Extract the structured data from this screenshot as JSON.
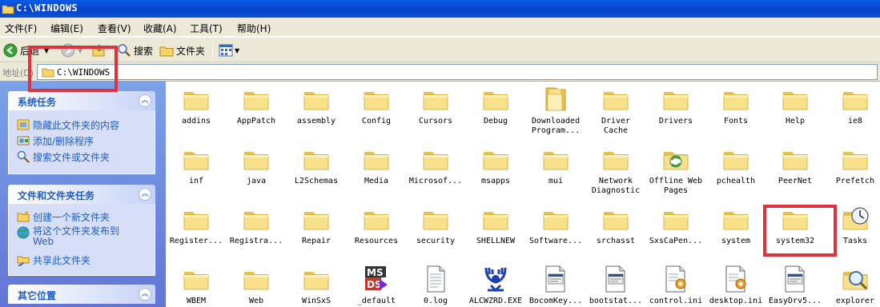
{
  "window": {
    "title": "C:\\WINDOWS"
  },
  "menu": [
    "文件(F)",
    "编辑(E)",
    "查看(V)",
    "收藏(A)",
    "工具(T)",
    "帮助(H)"
  ],
  "toolbar": {
    "back": "后退",
    "search": "搜索",
    "folders": "文件夹"
  },
  "address": {
    "label": "地址(D)",
    "value": "C:\\WINDOWS"
  },
  "taskpane": {
    "system_tasks": {
      "title": "系统任务",
      "items": [
        "隐藏此文件夹的内容",
        "添加/删除程序",
        "搜索文件或文件夹"
      ]
    },
    "file_tasks": {
      "title": "文件和文件夹任务",
      "items": [
        "创建一个新文件夹",
        "将这个文件夹发布到\nWeb",
        "共享此文件夹"
      ]
    },
    "other_places": {
      "title": "其它位置"
    }
  },
  "files": [
    {
      "label": "addins",
      "icon": "folder-icon"
    },
    {
      "label": "AppPatch",
      "icon": "folder-icon"
    },
    {
      "label": "assembly",
      "icon": "folder-icon"
    },
    {
      "label": "Config",
      "icon": "folder-icon"
    },
    {
      "label": "Cursors",
      "icon": "folder-icon"
    },
    {
      "label": "Debug",
      "icon": "folder-icon"
    },
    {
      "label": "Downloaded\nProgram...",
      "icon": "folder-open-icon"
    },
    {
      "label": "Driver\nCache",
      "icon": "folder-icon"
    },
    {
      "label": "Drivers",
      "icon": "folder-icon"
    },
    {
      "label": "Fonts",
      "icon": "folder-icon"
    },
    {
      "label": "Help",
      "icon": "folder-icon"
    },
    {
      "label": "ie8",
      "icon": "folder-icon"
    },
    {
      "label": "inf",
      "icon": "folder-icon"
    },
    {
      "label": "java",
      "icon": "folder-icon"
    },
    {
      "label": "L2Schemas",
      "icon": "folder-icon"
    },
    {
      "label": "Media",
      "icon": "folder-icon"
    },
    {
      "label": "Microsof...",
      "icon": "folder-icon"
    },
    {
      "label": "msapps",
      "icon": "folder-icon"
    },
    {
      "label": "mui",
      "icon": "folder-icon"
    },
    {
      "label": "Network\nDiagnostic",
      "icon": "folder-icon"
    },
    {
      "label": "Offline Web\nPages",
      "icon": "offline-web-folder-icon"
    },
    {
      "label": "pchealth",
      "icon": "folder-icon"
    },
    {
      "label": "PeerNet",
      "icon": "folder-icon"
    },
    {
      "label": "Prefetch",
      "icon": "folder-icon"
    },
    {
      "label": "Register...",
      "icon": "folder-icon"
    },
    {
      "label": "Registra...",
      "icon": "folder-icon"
    },
    {
      "label": "Repair",
      "icon": "folder-icon"
    },
    {
      "label": "Resources",
      "icon": "folder-icon"
    },
    {
      "label": "security",
      "icon": "folder-icon"
    },
    {
      "label": "SHELLNEW",
      "icon": "folder-icon"
    },
    {
      "label": "Software...",
      "icon": "folder-icon"
    },
    {
      "label": "srchasst",
      "icon": "folder-icon"
    },
    {
      "label": "SxsCaPen...",
      "icon": "folder-icon"
    },
    {
      "label": "system",
      "icon": "folder-icon"
    },
    {
      "label": "system32",
      "icon": "folder-icon"
    },
    {
      "label": "Tasks",
      "icon": "scheduled-tasks-icon"
    },
    {
      "label": "WBEM",
      "icon": "folder-icon"
    },
    {
      "label": "Web",
      "icon": "folder-icon"
    },
    {
      "label": "WinSxS",
      "icon": "folder-icon"
    },
    {
      "label": "_default",
      "icon": "msdos-icon"
    },
    {
      "label": "0.log",
      "icon": "text-file-icon"
    },
    {
      "label": "ALCWZRD.EXE",
      "icon": "realtek-exe-icon"
    },
    {
      "label": "BocomKey...",
      "icon": "settings-file-icon"
    },
    {
      "label": "bootstat...",
      "icon": "settings-file-icon"
    },
    {
      "label": "control.ini",
      "icon": "ini-file-icon"
    },
    {
      "label": "desktop.ini",
      "icon": "ini-file-icon"
    },
    {
      "label": "EasyDrv5...",
      "icon": "settings-file-icon"
    },
    {
      "label": "explorer",
      "icon": "explorer-exe-icon"
    }
  ],
  "colors": {
    "highlight_box": "#e0323c",
    "title_bar": "#0a5ce6",
    "task_link": "#215dc6"
  }
}
